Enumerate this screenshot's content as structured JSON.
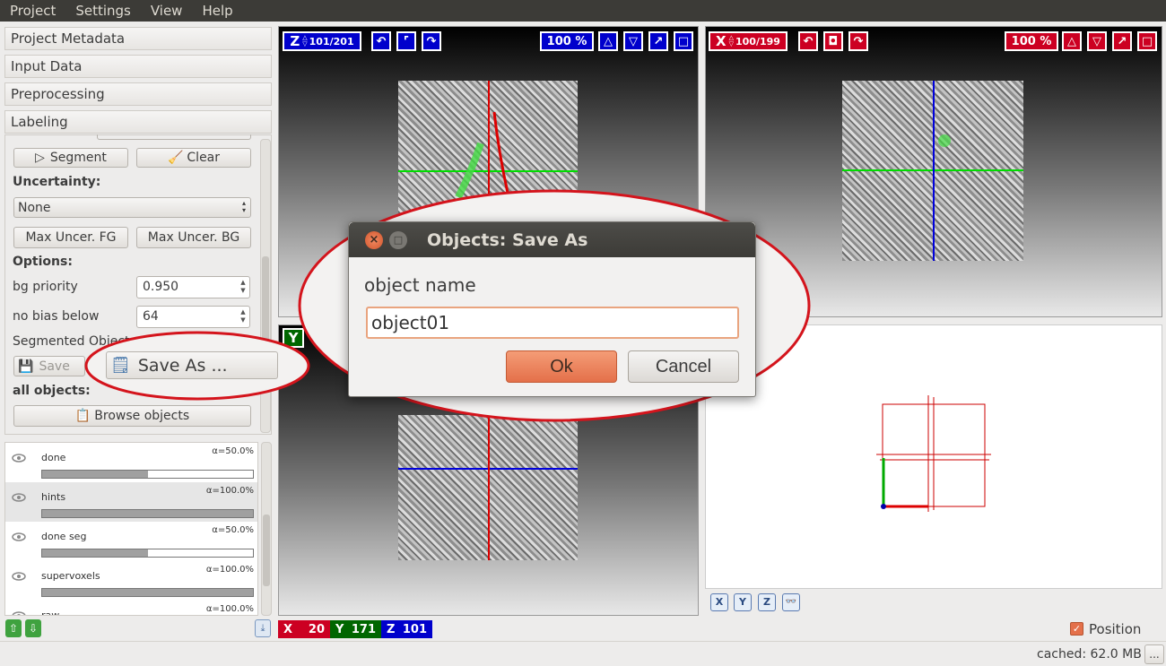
{
  "menubar": {
    "items": [
      "Project",
      "Settings",
      "View",
      "Help"
    ]
  },
  "applets": [
    "Project Metadata",
    "Input Data",
    "Preprocessing",
    "Labeling"
  ],
  "labeling": {
    "segment_label": "Segment",
    "clear_label": "Clear",
    "uncertainty_label": "Uncertainty:",
    "uncertainty_value": "None",
    "max_uncer_fg": "Max Uncer. FG",
    "max_uncer_bg": "Max Uncer. BG",
    "options_label": "Options:",
    "bg_priority_label": "bg priority",
    "bg_priority_value": "0.950",
    "no_bias_label": "no bias below",
    "no_bias_value": "64",
    "segmented_label": "Segmented Object",
    "save_label": "Save",
    "save_as_label": "Save As ...",
    "all_objects_label": "all objects:",
    "browse_label": "Browse objects"
  },
  "layers": [
    {
      "name": "done",
      "alpha": "α=50.0%",
      "opacity": 0.5
    },
    {
      "name": "hints",
      "alpha": "α=100.0%",
      "opacity": 1.0
    },
    {
      "name": "done seg",
      "alpha": "α=50.0%",
      "opacity": 0.5
    },
    {
      "name": "supervoxels",
      "alpha": "α=100.0%",
      "opacity": 1.0
    },
    {
      "name": "raw",
      "alpha": "α=100.0%",
      "opacity": 1.0
    }
  ],
  "viewers": {
    "z": {
      "axis": "Z",
      "slice": "101/201",
      "zoom": "100 %"
    },
    "x": {
      "axis": "X",
      "slice": "100/199",
      "zoom": "100 %"
    },
    "y": {
      "axis": "Y"
    }
  },
  "position": {
    "x_label": "X",
    "x": "20",
    "y_label": "Y",
    "y": "171",
    "z_label": "Z",
    "z": "101"
  },
  "view3d": {
    "buttons": [
      "X",
      "Y",
      "Z"
    ]
  },
  "dialog": {
    "title": "Objects: Save As",
    "field_label": "object name",
    "field_value": "object01",
    "ok_label": "Ok",
    "cancel_label": "Cancel"
  },
  "status": {
    "position_label": "Position",
    "position_checked": true,
    "cached": "cached: 62.0 MB",
    "more": "..."
  },
  "colors": {
    "menubar": "#3c3b37",
    "accent": "#e4704a",
    "axis_x": "#cc0022",
    "axis_y": "#006600",
    "axis_z": "#0000cc"
  }
}
